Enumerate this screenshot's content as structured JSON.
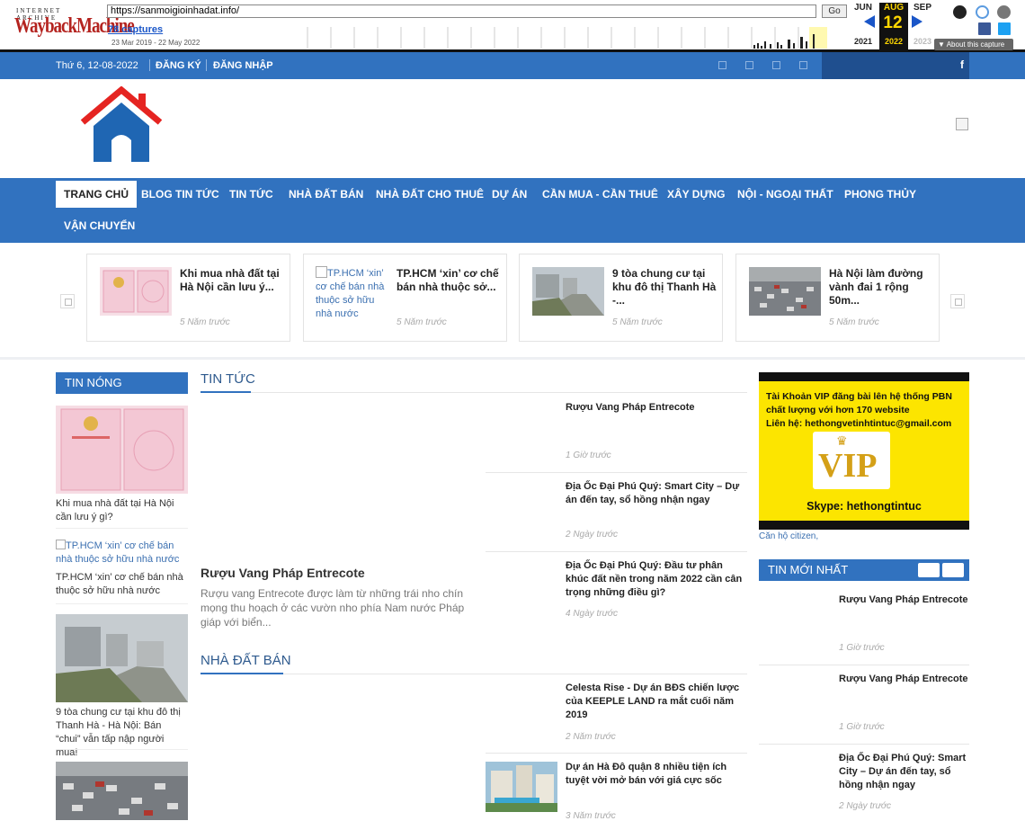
{
  "wayback": {
    "logo_top": "INTERNET ARCHIVE",
    "logo_main": "WaybackMachine",
    "url": "https://sanmoigioinhadat.info/",
    "go_label": "Go",
    "captures_label": "78 captures",
    "date_range": "23 Mar 2019 - 22 May 2022",
    "months": [
      "JUN",
      "AUG",
      "SEP"
    ],
    "day": "12",
    "years": [
      "2021",
      "2022",
      "2023"
    ],
    "about_label": "About this capture"
  },
  "topbar": {
    "date": "Thứ 6, 12-08-2022",
    "register": "ĐĂNG KÝ",
    "login": "ĐĂNG NHẬP",
    "search_icon": "f"
  },
  "nav": {
    "items": [
      "TRANG CHỦ",
      "BLOG TIN TỨC",
      "TIN TỨC",
      "NHÀ ĐẤT BÁN",
      "NHÀ ĐẤT CHO THUÊ",
      "DỰ ÁN",
      "CẦN MUA - CẦN THUÊ",
      "XÂY DỰNG",
      "NỘI - NGOẠI THẤT",
      "PHONG THỦY",
      "VẬN CHUYỂN"
    ]
  },
  "carousel": [
    {
      "title": "Khi mua nhà đất tại Hà Nội cần lưu ý...",
      "time": "5 Năm trước",
      "thumb": "document-pink"
    },
    {
      "title": "TP.HCM ‘xin’ cơ chế bán nhà thuộc sở...",
      "time": "5 Năm trước",
      "alt": "TP.HCM ‘xin’ cơ chế bán nhà thuộc sở hữu nhà nước"
    },
    {
      "title": "9 tòa chung cư tại khu đô thị Thanh Hà -...",
      "time": "5 Năm trước",
      "thumb": "road-apartments"
    },
    {
      "title": "Hà Nội làm đường vành đai 1 rộng 50m...",
      "time": "5 Năm trước",
      "thumb": "traffic"
    }
  ],
  "left_sidebar": {
    "heading": "TIN NÓNG",
    "items": [
      {
        "text": "Khi mua nhà đất tại Hà Nội cần lưu ý gì?"
      },
      {
        "alt": "TP.HCM ‘xin’ cơ chế bán nhà thuộc sở hữu nhà nước",
        "text": "TP.HCM ‘xin’ cơ chế bán nhà thuộc sở hữu nhà nước"
      },
      {
        "text": "9 tòa chung cư tại khu đô thị Thanh Hà - Hà Nội: Bán “chui” vẫn tấp nập người mua!"
      }
    ]
  },
  "center": {
    "section1": {
      "heading": "TIN TỨC",
      "featured_title": "Rượu Vang Pháp Entrecote",
      "featured_desc": "Rượu vang Entrecote được làm từ những trái nho chín mọng thu hoạch ở các vườn nho phía Nam nước Pháp giáp với biển...",
      "list": [
        {
          "title": "Rượu Vang Pháp Entrecote",
          "time": "1 Giờ trước"
        },
        {
          "title": "Địa Ốc Đại Phú Quý: Smart City – Dự án đến tay, sổ hồng nhận ngay",
          "time": "2 Ngày trước"
        },
        {
          "title": "Địa Ốc Đại Phú Quý: Đầu tư phân khúc đất nền trong năm 2022 cần cân trọng những điều gì?",
          "time": "4 Ngày trước"
        }
      ]
    },
    "section2": {
      "heading": "NHÀ ĐẤT BÁN",
      "list": [
        {
          "title": "Celesta Rise - Dự án BĐS chiến lược của KEEPLE LAND ra mắt cuối năm 2019",
          "time": "2 Năm trước"
        },
        {
          "title": "Dự án Hà Đô quận 8 nhiều tiện ích tuyệt vời mở bán với giá cực sốc",
          "time": "3 Năm trước"
        }
      ]
    }
  },
  "right_sidebar": {
    "ad": {
      "line1": "Tài Khoản VIP đăng bài lên hệ thống PBN",
      "line2": "chất lượng với hơn 170 website",
      "line3": "Liên hệ: hethongvetinhtintuc@gmail.com",
      "vip": "VIP",
      "skype": "Skype: hethongtintuc"
    },
    "ad_caption": "Căn hộ citizen,",
    "latest_heading": "TIN MỚI NHẤT",
    "latest": [
      {
        "title": "Rượu Vang Pháp Entrecote",
        "time": "1 Giờ trước"
      },
      {
        "title": "Rượu Vang Pháp Entrecote",
        "time": "1 Giờ trước"
      },
      {
        "title": "Địa Ốc Đại Phú Quý: Smart City – Dự án đến tay, sổ hồng nhận ngay",
        "time": "2 Ngày trước"
      }
    ]
  },
  "colors": {
    "brand_blue": "#3172bf",
    "ad_yellow": "#fce500",
    "logo_red": "#e52421"
  }
}
